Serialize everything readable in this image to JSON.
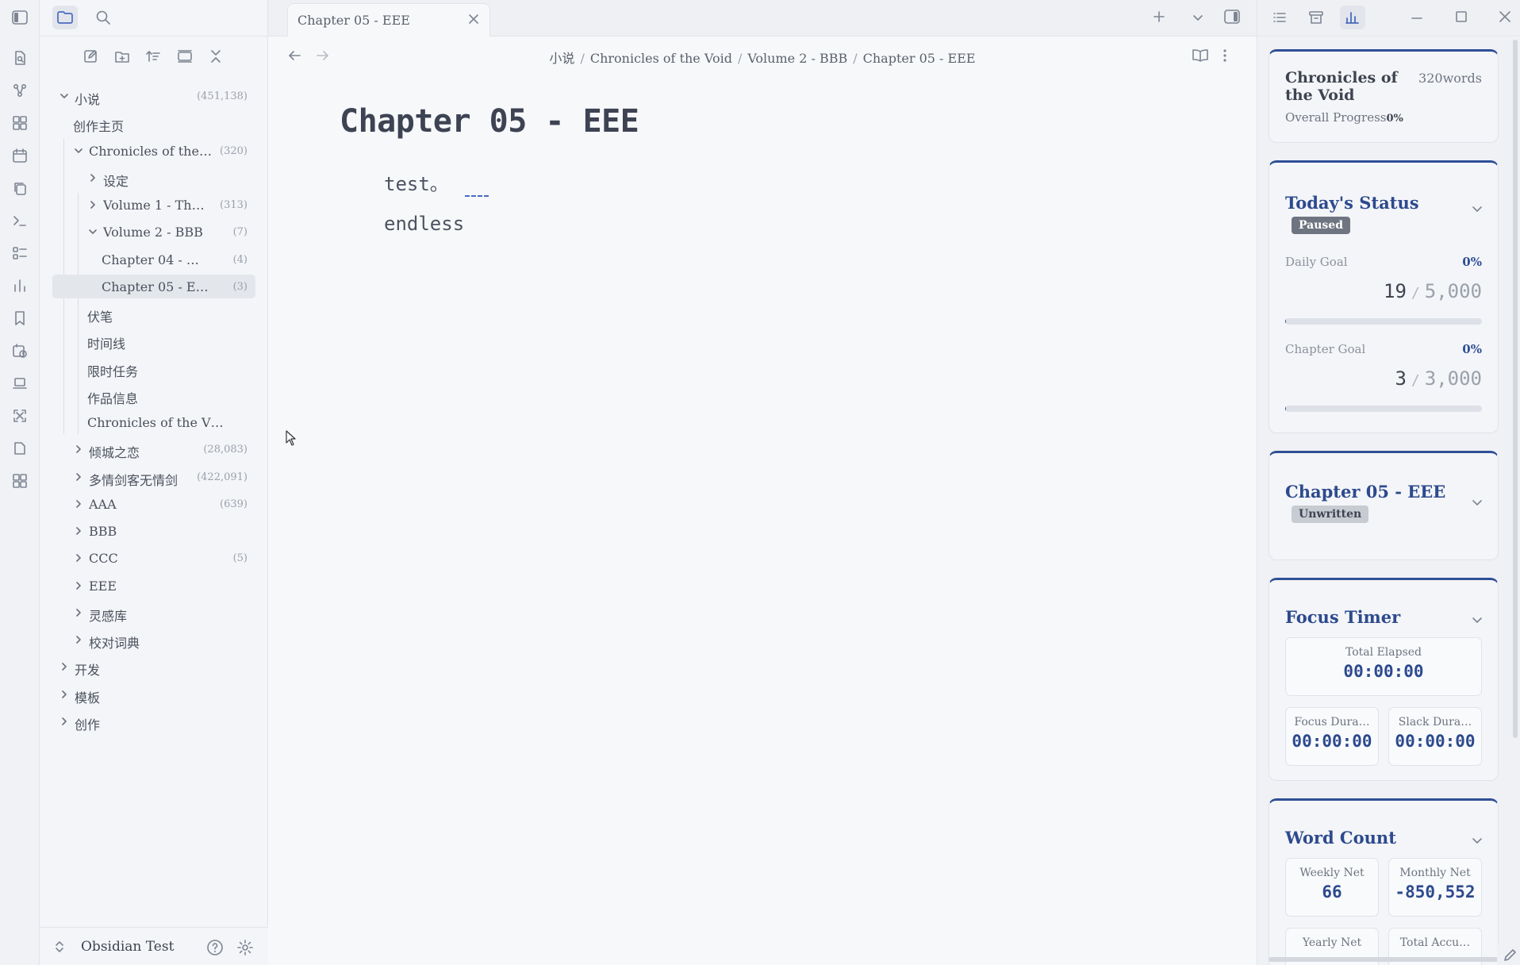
{
  "sidebar": {
    "tree": [
      {
        "label": "小说",
        "count": "(451,138)"
      },
      {
        "label": "创作主页",
        "count": ""
      },
      {
        "label": "Chronicles of the…",
        "count": "(320)"
      },
      {
        "label": "设定",
        "count": ""
      },
      {
        "label": "Volume 1 - Th…",
        "count": "(313)"
      },
      {
        "label": "Volume 2 - BBB",
        "count": "(7)"
      },
      {
        "label": "Chapter 04 - …",
        "count": "(4)"
      },
      {
        "label": "Chapter 05 - E…",
        "count": "(3)"
      },
      {
        "label": "伏笔",
        "count": ""
      },
      {
        "label": "时间线",
        "count": ""
      },
      {
        "label": "限时任务",
        "count": ""
      },
      {
        "label": "作品信息",
        "count": ""
      },
      {
        "label": "Chronicles of the V…",
        "count": ""
      },
      {
        "label": "倾城之恋",
        "count": "(28,083)"
      },
      {
        "label": "多情剑客无情剑",
        "count": "(422,091)"
      },
      {
        "label": "AAA",
        "count": "(639)"
      },
      {
        "label": "BBB",
        "count": ""
      },
      {
        "label": "CCC",
        "count": "(5)"
      },
      {
        "label": "EEE",
        "count": ""
      },
      {
        "label": "灵感库",
        "count": ""
      },
      {
        "label": "校对词典",
        "count": ""
      },
      {
        "label": "开发",
        "count": ""
      },
      {
        "label": "模板",
        "count": ""
      },
      {
        "label": "创作",
        "count": ""
      }
    ],
    "vault_name": "Obsidian Test"
  },
  "editor": {
    "tab_title": "Chapter 05 - EEE",
    "breadcrumb": [
      "小说",
      "Chronicles of the Void",
      "Volume 2 - BBB",
      "Chapter 05 - EEE"
    ],
    "doc_title": "Chapter 05 - EEE",
    "lines": [
      "test。",
      "endless"
    ]
  },
  "panel": {
    "book": {
      "title": "Chronicles of the Void",
      "words": "320words",
      "progress_label": "Overall Progress",
      "progress_value": "0%"
    },
    "today": {
      "title": "Today's Status",
      "badge": "Paused",
      "daily_label": "Daily Goal",
      "daily_pct": "0%",
      "daily_value": "19",
      "daily_total": "5,000",
      "daily_fill": 0.0038,
      "chapter_label": "Chapter Goal",
      "chapter_pct": "0%",
      "chapter_value": "3",
      "chapter_total": "3,000",
      "chapter_fill": 0.001
    },
    "chapter": {
      "title": "Chapter 05 - EEE",
      "badge": "Unwritten"
    },
    "timer": {
      "title": "Focus Timer",
      "total_label": "Total Elapsed",
      "total_value": "00:00:00",
      "focus_label": "Focus Dura…",
      "focus_value": "00:00:00",
      "slack_label": "Slack Dura…",
      "slack_value": "00:00:00"
    },
    "wordcount": {
      "title": "Word Count",
      "weekly_label": "Weekly Net",
      "weekly_value": "66",
      "monthly_label": "Monthly Net",
      "monthly_value": "-850,552",
      "yearly_label": "Yearly Net",
      "total_label": "Total Accu…"
    }
  },
  "colors": {
    "accent": "#2f4f96",
    "paused_badge": "#6e7480",
    "unwritten_badge": "#c7cbd2"
  }
}
